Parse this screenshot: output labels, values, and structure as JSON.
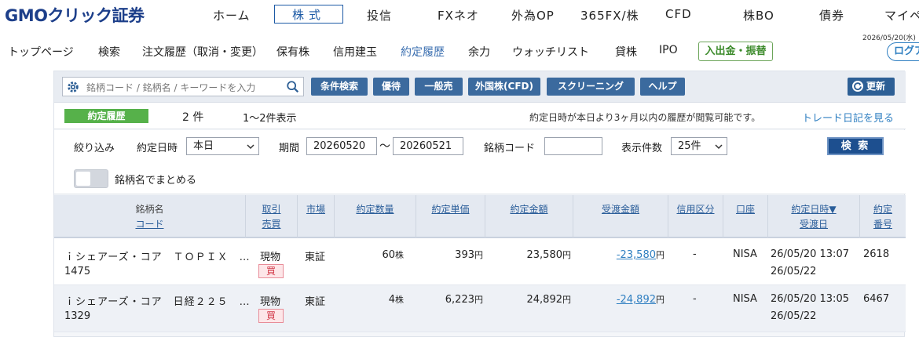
{
  "brand": {
    "logo_text": "GMOクリック証券"
  },
  "top_nav": {
    "items": [
      {
        "label": "ホーム"
      },
      {
        "label": "株式"
      },
      {
        "label": "投信"
      },
      {
        "label": "FXネオ"
      },
      {
        "label": "外為OP"
      },
      {
        "label": "365FX/株"
      },
      {
        "label": "CFD"
      },
      {
        "label": "株BO"
      },
      {
        "label": "債券"
      },
      {
        "label": "マイペ"
      }
    ],
    "active": "株式"
  },
  "sub_nav": {
    "items": [
      {
        "label": "トップページ"
      },
      {
        "label": "検索"
      },
      {
        "label": "注文履歴（取消・変更）"
      },
      {
        "label": "保有株"
      },
      {
        "label": "信用建玉"
      },
      {
        "label": "約定履歴"
      },
      {
        "label": "余力"
      },
      {
        "label": "ウォッチリスト"
      },
      {
        "label": "貸株"
      },
      {
        "label": "IPO"
      }
    ],
    "active": "約定履歴",
    "deposit_button": "入出金・振替",
    "date": "2026/05/20(水)",
    "logout": "ログア"
  },
  "search": {
    "placeholder": "銘柄コード / 銘柄名 / キーワードを入力",
    "buttons": [
      "条件検索",
      "優待",
      "一般売",
      "外国株(CFD)",
      "スクリーニング",
      "ヘルプ"
    ],
    "refresh": "更新"
  },
  "info": {
    "badge": "約定履歴",
    "count": "2 件",
    "range": "1〜2件表示",
    "note": "約定日時が本日より3ヶ月以内の履歴が閲覧可能です。",
    "diary_link": "トレード日記を見る"
  },
  "filter": {
    "label_narrow": "絞り込み",
    "label_date": "約定日時",
    "date_option": "本日",
    "label_period": "期間",
    "period_from": "20260520",
    "period_sep": "〜",
    "period_to": "20260521",
    "label_code": "銘柄コード",
    "code_value": "",
    "label_per_page": "表示件数",
    "per_page": "25件",
    "search_button": "検 索"
  },
  "toggle": {
    "label": "銘柄名でまとめる",
    "on": false
  },
  "table": {
    "headers": {
      "name": [
        "銘柄名",
        "コード"
      ],
      "trade": [
        "取引",
        "売買"
      ],
      "market": "市場",
      "qty": "約定数量",
      "price": "約定単価",
      "amount": "約定金額",
      "settle": "受渡金額",
      "credit": "信用区分",
      "account": "口座",
      "datetime": [
        "約定日時▼",
        "受渡日"
      ],
      "number": [
        "約定",
        "番号"
      ]
    },
    "rows": [
      {
        "name": "ｉシェアーズ・コア　ＴＯＰＩＸ　…",
        "code": "1475",
        "trade": "現物",
        "side": "買",
        "market": "東証",
        "qty": "60",
        "qty_unit": "株",
        "price": "393",
        "price_unit": "円",
        "amount": "23,580",
        "amount_unit": "円",
        "settle": "-23,580",
        "settle_unit": "円",
        "credit": "-",
        "account": "NISA",
        "datetime": "26/05/20 13:07",
        "settle_date": "26/05/22",
        "number": "2618"
      },
      {
        "name": "ｉシェアーズ・コア　日経２２５　…",
        "code": "1329",
        "trade": "現物",
        "side": "買",
        "market": "東証",
        "qty": "4",
        "qty_unit": "株",
        "price": "6,223",
        "price_unit": "円",
        "amount": "24,892",
        "amount_unit": "円",
        "settle": "-24,892",
        "settle_unit": "円",
        "credit": "-",
        "account": "NISA",
        "datetime": "26/05/20 13:05",
        "settle_date": "26/05/22",
        "number": "6467"
      }
    ]
  },
  "colors": {
    "brand": "#1d3f8a",
    "accent": "#2f7fc1",
    "badge_green": "#56b14a",
    "buy_red": "#d23c4b"
  }
}
